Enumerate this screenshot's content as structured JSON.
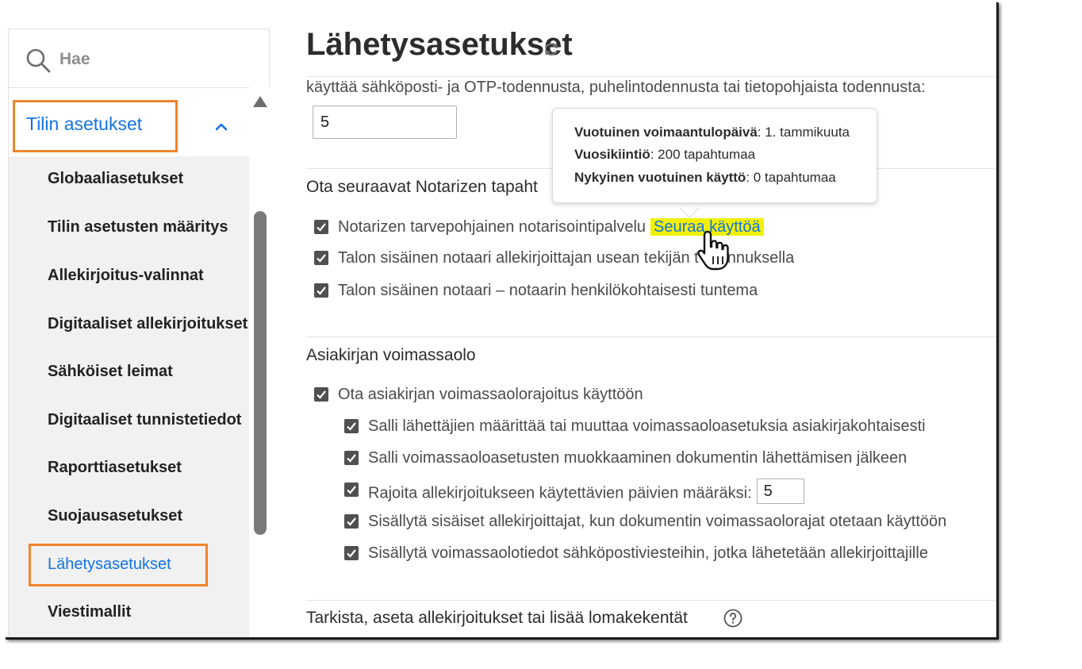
{
  "search": {
    "placeholder": "Hae"
  },
  "sidebar": {
    "section_title": "Tilin asetukset",
    "items": [
      {
        "label": "Globaaliasetukset"
      },
      {
        "label": "Tilin asetusten määritys"
      },
      {
        "label": "Allekirjoitus-valinnat"
      },
      {
        "label": "Digitaaliset allekirjoitukset"
      },
      {
        "label": "Sähköiset leimat"
      },
      {
        "label": "Digitaaliset tunnistetiedot"
      },
      {
        "label": "Raporttiasetukset"
      },
      {
        "label": "Suojausasetukset"
      },
      {
        "label": "Lähetysasetukset",
        "active": true
      },
      {
        "label": "Viestimallit"
      }
    ]
  },
  "main": {
    "title": "Lähetysasetukset",
    "auth_text": "käyttää sähköposti- ja OTP-todennusta, puhelintodennusta tai tietopohjaista todennusta:",
    "auth_value": "5",
    "notarize": {
      "heading": "Ota seuraavat Notarizen tapaht",
      "items": [
        {
          "label": "Notarizen tarvepohjainen notarisointipalvelu",
          "link": "Seuraa käyttöä"
        },
        {
          "label": "Talon sisäinen notaari allekirjoittajan usean tekijän t",
          "label_tail": "nnuksella"
        },
        {
          "label": "Talon sisäinen notaari – notaarin henkilökohtaisesti tuntema"
        }
      ]
    },
    "validity": {
      "heading": "Asiakirjan voimassaolo",
      "enable_label": "Ota asiakirjan voimassaolorajoitus käyttöön",
      "sub_items": [
        {
          "label": "Salli lähettäjien määrittää tai muuttaa voimassaoloasetuksia asiakirjakohtaisesti"
        },
        {
          "label": "Salli voimassaoloasetusten muokkaaminen dokumentin lähettämisen jälkeen"
        },
        {
          "label": "Rajoita allekirjoitukseen käytettävien päivien määräksi:",
          "value": "5"
        },
        {
          "label": "Sisällytä sisäiset allekirjoittajat, kun dokumentin voimassaolorajat otetaan käyttöön"
        },
        {
          "label": "Sisällytä voimassaolotiedot sähköpostiviesteihin, jotka lähetetään allekirjoittajille"
        }
      ]
    },
    "review_heading": "Tarkista, aseta allekirjoitukset tai lisää lomakekentät"
  },
  "tooltip": {
    "rows": [
      {
        "key": "Vuotuinen voimaantulopäivä",
        "value": ": 1. tammikuuta"
      },
      {
        "key": "Vuosikiintiö",
        "value": ": 200 tapahtumaa"
      },
      {
        "key": "Nykyinen vuotuinen käyttö",
        "value": ": 0 tapahtumaa"
      }
    ]
  },
  "colors": {
    "accent": "#1473e6",
    "highlight_box": "#f0842c",
    "link_highlight": "#f1f000",
    "checkbox": "#505050"
  }
}
